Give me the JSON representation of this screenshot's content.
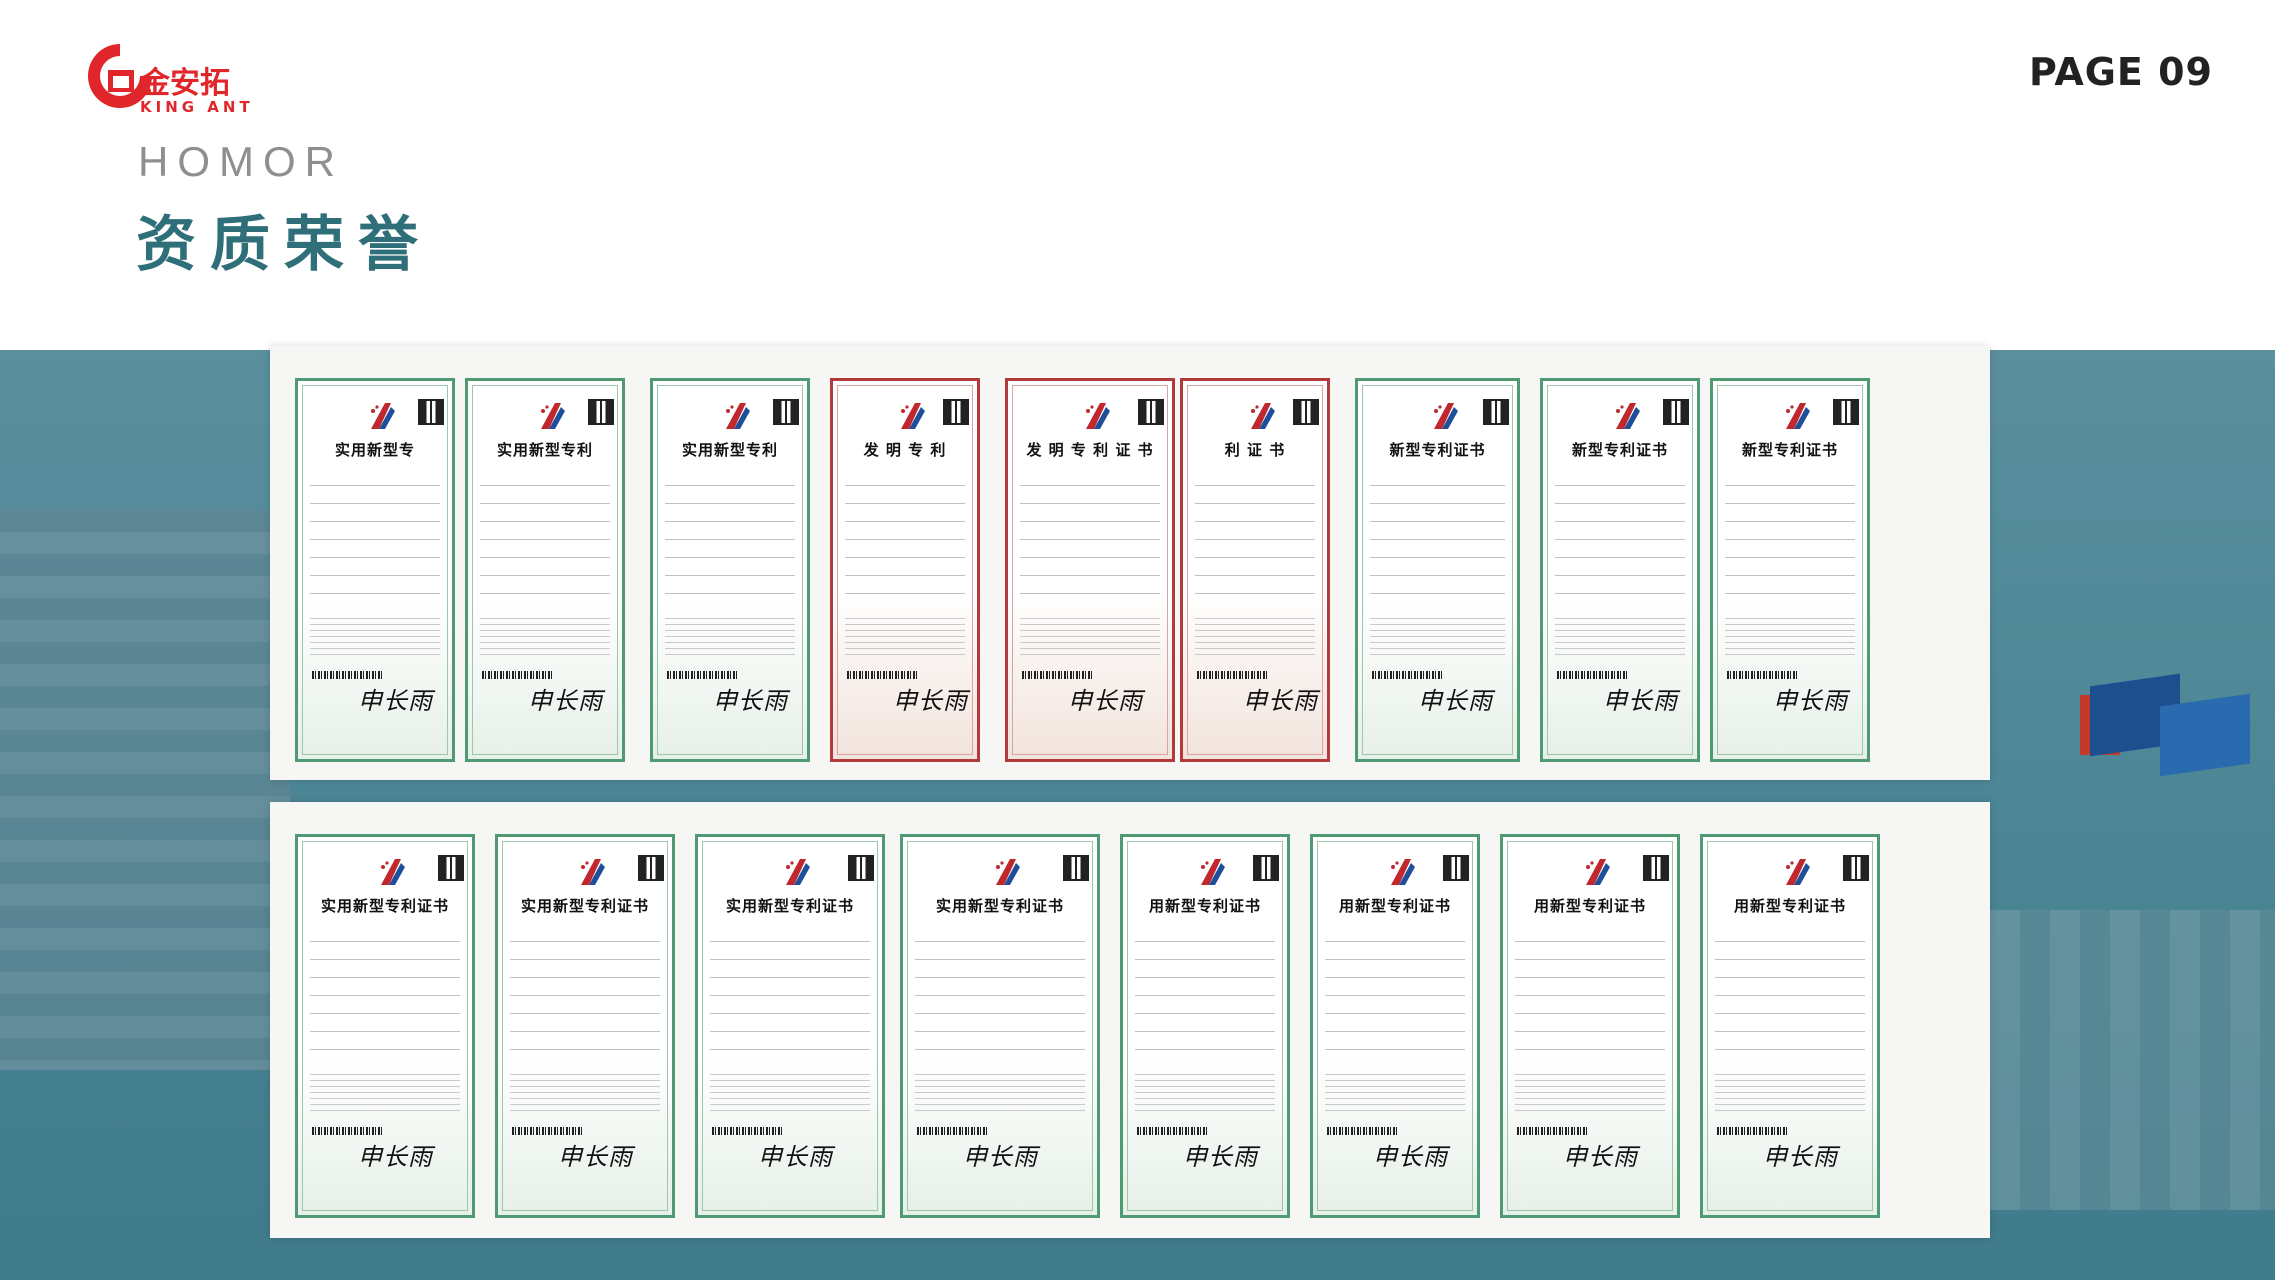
{
  "brand": {
    "name_cn": "金安拓",
    "name_en": "KING ANT",
    "color": "#e0262b"
  },
  "page": {
    "number": "PAGE 09"
  },
  "section": {
    "title_en": "HOMOR",
    "title_cn": "资质荣誉",
    "accent": "#2e6f7a"
  },
  "certificates": {
    "row1": [
      {
        "title": "实用新型专",
        "type": "utility",
        "color": "#4f9a72"
      },
      {
        "title": "实用新型专利",
        "type": "utility",
        "color": "#4f9a72"
      },
      {
        "title": "实用新型专利",
        "type": "utility",
        "color": "#4f9a72"
      },
      {
        "title": "发 明 专 利",
        "type": "invention",
        "color": "#b33a3a"
      },
      {
        "title": "发 明 专 利 证 书",
        "type": "invention",
        "color": "#b33a3a"
      },
      {
        "title": "利 证 书",
        "type": "invention",
        "color": "#b33a3a"
      },
      {
        "title": "新型专利证书",
        "type": "utility",
        "color": "#4f9a72"
      },
      {
        "title": "新型专利证书",
        "type": "utility",
        "color": "#4f9a72"
      },
      {
        "title": "新型专利证书",
        "type": "utility",
        "color": "#4f9a72"
      }
    ],
    "row2": [
      {
        "title": "实用新型专利证书",
        "type": "utility",
        "color": "#4f9a72"
      },
      {
        "title": "实用新型专利证书",
        "type": "utility",
        "color": "#4f9a72"
      },
      {
        "title": "实用新型专利证书",
        "type": "utility",
        "color": "#4f9a72"
      },
      {
        "title": "实用新型专利证书",
        "type": "utility",
        "color": "#4f9a72"
      },
      {
        "title": "用新型专利证书",
        "type": "utility",
        "color": "#4f9a72"
      },
      {
        "title": "用新型专利证书",
        "type": "utility",
        "color": "#4f9a72"
      },
      {
        "title": "用新型专利证书",
        "type": "utility",
        "color": "#4f9a72"
      },
      {
        "title": "用新型专利证书",
        "type": "utility",
        "color": "#4f9a72"
      }
    ]
  }
}
